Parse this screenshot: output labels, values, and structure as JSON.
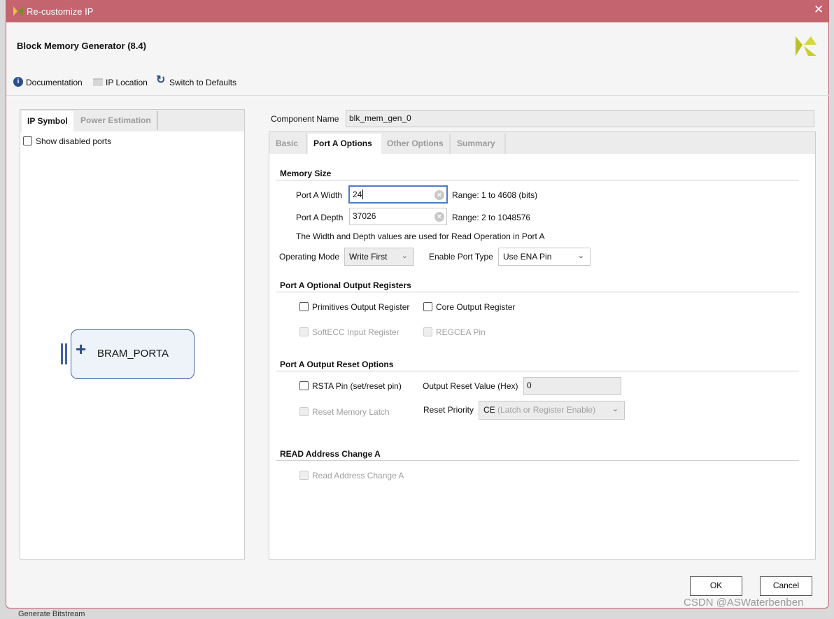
{
  "window": {
    "title": "Re-customize IP",
    "close_icon": "close-icon"
  },
  "header": {
    "title": "Block Memory Generator (8.4)"
  },
  "toolbar": {
    "documentation": "Documentation",
    "ip_location": "IP Location",
    "switch_defaults": "Switch to Defaults"
  },
  "left_panel": {
    "tabs": [
      {
        "label": "IP Symbol",
        "active": true
      },
      {
        "label": "Power Estimation",
        "active": false
      }
    ],
    "show_disabled_ports": "Show disabled ports",
    "symbol_port": "BRAM_PORTA"
  },
  "component": {
    "label": "Component Name",
    "value": "blk_mem_gen_0"
  },
  "tabs": [
    {
      "label": "Basic",
      "active": false
    },
    {
      "label": "Port A Options",
      "active": true
    },
    {
      "label": "Other Options",
      "active": false
    },
    {
      "label": "Summary",
      "active": false
    }
  ],
  "memory_size": {
    "title": "Memory Size",
    "width_label": "Port A Width",
    "width_value": "24",
    "width_range": "Range: 1 to 4608 (bits)",
    "depth_label": "Port A Depth",
    "depth_value": "37026",
    "depth_range": "Range: 2 to 1048576",
    "note": "The Width and Depth values are used for Read Operation in Port A",
    "op_mode_label": "Operating Mode",
    "op_mode_value": "Write First",
    "enable_label": "Enable Port Type",
    "enable_value": "Use ENA Pin"
  },
  "optional_regs": {
    "title": "Port A Optional Output Registers",
    "primitives": "Primitives Output Register",
    "core": "Core Output Register",
    "softecc": "SoftECC Input Register",
    "regcea": "REGCEA Pin"
  },
  "reset_options": {
    "title": "Port A Output Reset Options",
    "rsta": "RSTA Pin (set/reset pin)",
    "reset_value_label": "Output Reset Value (Hex)",
    "reset_value": "0",
    "latch": "Reset Memory Latch",
    "priority_label": "Reset Priority",
    "priority_value_main": "CE",
    "priority_value_desc": "(Latch or Register Enable)"
  },
  "read_addr": {
    "title": "READ Address Change A",
    "checkbox": "Read Address Change A"
  },
  "footer": {
    "ok": "OK",
    "cancel": "Cancel"
  },
  "background": {
    "taskbar_item": "Generate Bitstream"
  },
  "watermark": "CSDN @ASWaterbenben",
  "colors": {
    "titlebar": "#c4646f",
    "focus": "#4a7cc9",
    "symbol_fill": "#eef3fa",
    "symbol_border": "#3f64a8"
  }
}
